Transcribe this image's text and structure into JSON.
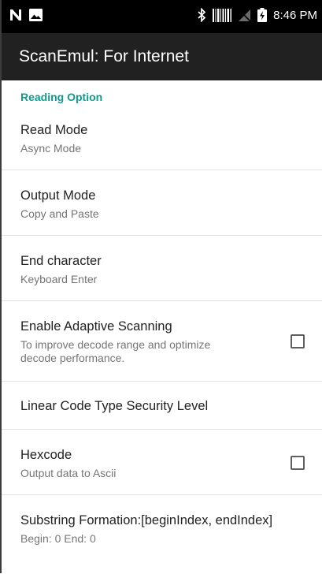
{
  "status_bar": {
    "time": "8:46 PM",
    "icons": [
      "notification-n-icon",
      "image-icon",
      "bluetooth-icon",
      "barcode-icon",
      "no-signal-icon",
      "battery-charging-icon"
    ]
  },
  "app_bar": {
    "title": "ScanEmul: For Internet"
  },
  "section": {
    "header": "Reading Option"
  },
  "prefs": [
    {
      "title": "Read Mode",
      "summary": "Async Mode"
    },
    {
      "title": "Output Mode",
      "summary": "Copy and Paste"
    },
    {
      "title": "End character",
      "summary": "Keyboard Enter"
    },
    {
      "title": "Enable Adaptive Scanning",
      "summary": "To improve decode range and optimize decode performance.",
      "checked": false
    },
    {
      "title": "Linear Code Type Security Level"
    },
    {
      "title": "Hexcode",
      "summary": "Output data to Ascii",
      "checked": false
    },
    {
      "title": "Substring Formation:[beginIndex, endIndex]",
      "summary": "Begin: 0 End: 0"
    }
  ],
  "colors": {
    "accent": "#0f9a8c",
    "app_bar": "#212121",
    "status_bar": "#000000"
  }
}
